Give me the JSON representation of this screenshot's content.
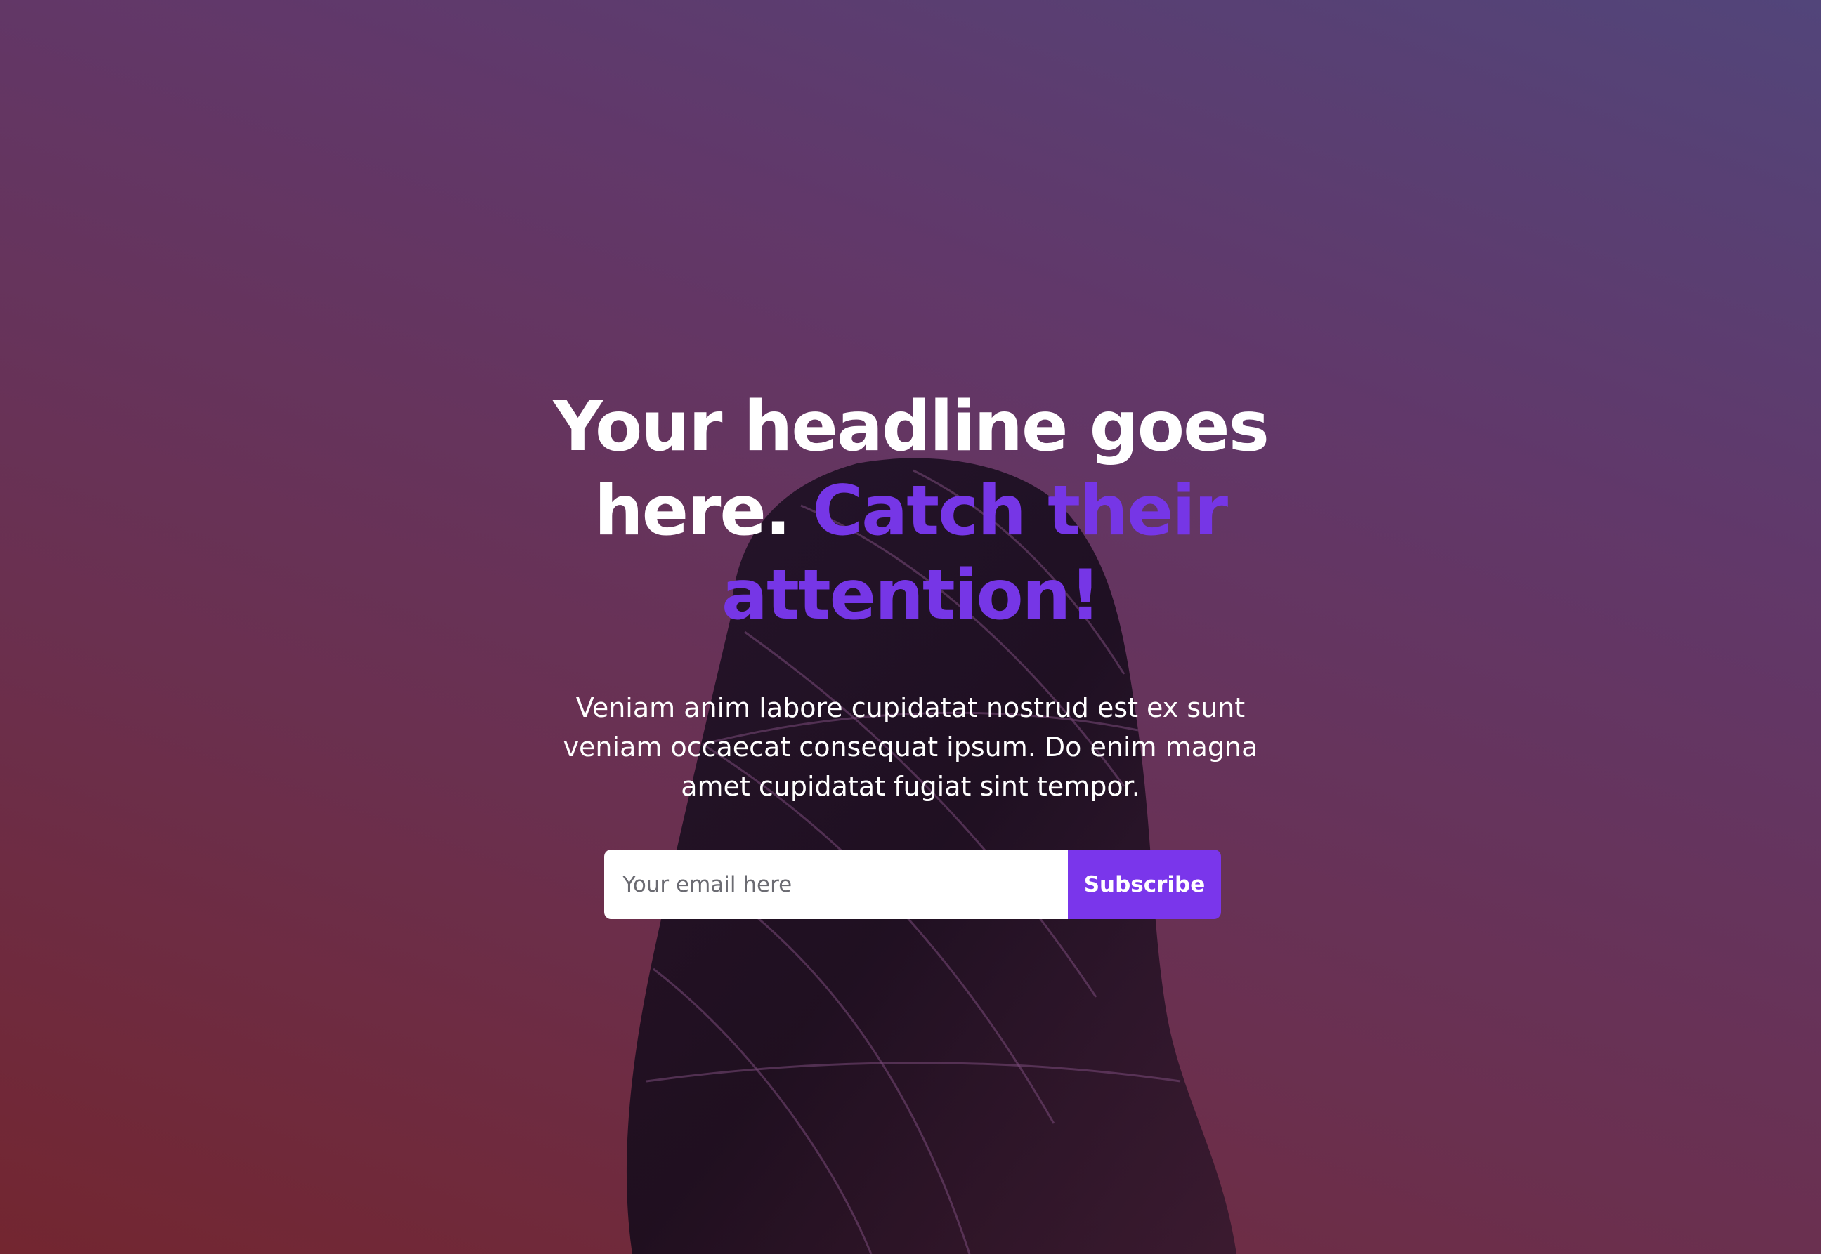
{
  "hero": {
    "headline_part1": "Your headline goes here.",
    "headline_accent": "Catch their attention!",
    "subtext": "Veniam anim labore cupidatat nostrud est ex sunt veniam occaecat consequat ipsum. Do enim magna amet cupidatat fugiat sint tempor.",
    "background_image": "skyscraper-photo"
  },
  "signup": {
    "email_placeholder": "Your email here",
    "email_value": "",
    "subscribe_label": "Subscribe"
  },
  "colors": {
    "accent": "#7636e6",
    "button": "#7a36eb",
    "text": "#ffffff",
    "gradient_top_right": "#52457a",
    "gradient_bottom_left": "#732630"
  }
}
